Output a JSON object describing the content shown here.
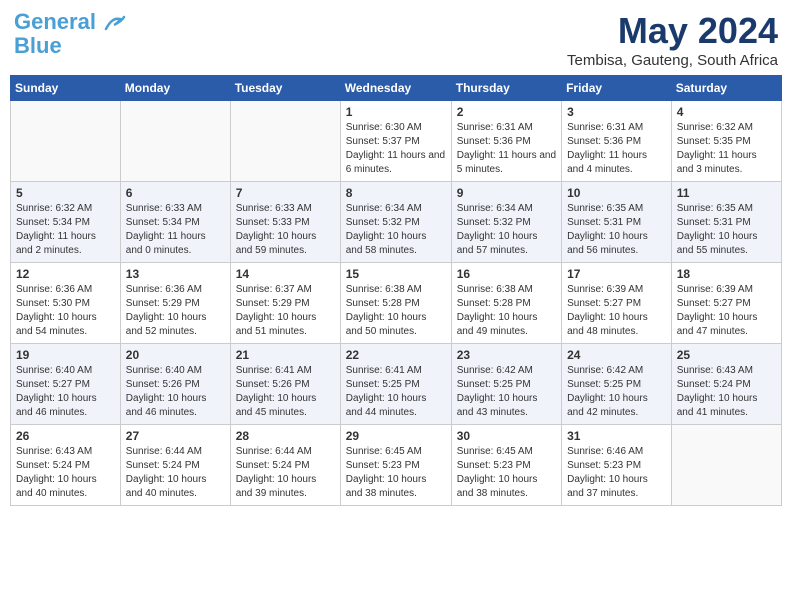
{
  "header": {
    "logo_line1": "General",
    "logo_line2": "Blue",
    "month_title": "May 2024",
    "location": "Tembisa, Gauteng, South Africa"
  },
  "days_of_week": [
    "Sunday",
    "Monday",
    "Tuesday",
    "Wednesday",
    "Thursday",
    "Friday",
    "Saturday"
  ],
  "weeks": [
    [
      {
        "day": "",
        "sunrise": "",
        "sunset": "",
        "daylight": ""
      },
      {
        "day": "",
        "sunrise": "",
        "sunset": "",
        "daylight": ""
      },
      {
        "day": "",
        "sunrise": "",
        "sunset": "",
        "daylight": ""
      },
      {
        "day": "1",
        "sunrise": "Sunrise: 6:30 AM",
        "sunset": "Sunset: 5:37 PM",
        "daylight": "Daylight: 11 hours and 6 minutes."
      },
      {
        "day": "2",
        "sunrise": "Sunrise: 6:31 AM",
        "sunset": "Sunset: 5:36 PM",
        "daylight": "Daylight: 11 hours and 5 minutes."
      },
      {
        "day": "3",
        "sunrise": "Sunrise: 6:31 AM",
        "sunset": "Sunset: 5:36 PM",
        "daylight": "Daylight: 11 hours and 4 minutes."
      },
      {
        "day": "4",
        "sunrise": "Sunrise: 6:32 AM",
        "sunset": "Sunset: 5:35 PM",
        "daylight": "Daylight: 11 hours and 3 minutes."
      }
    ],
    [
      {
        "day": "5",
        "sunrise": "Sunrise: 6:32 AM",
        "sunset": "Sunset: 5:34 PM",
        "daylight": "Daylight: 11 hours and 2 minutes."
      },
      {
        "day": "6",
        "sunrise": "Sunrise: 6:33 AM",
        "sunset": "Sunset: 5:34 PM",
        "daylight": "Daylight: 11 hours and 0 minutes."
      },
      {
        "day": "7",
        "sunrise": "Sunrise: 6:33 AM",
        "sunset": "Sunset: 5:33 PM",
        "daylight": "Daylight: 10 hours and 59 minutes."
      },
      {
        "day": "8",
        "sunrise": "Sunrise: 6:34 AM",
        "sunset": "Sunset: 5:32 PM",
        "daylight": "Daylight: 10 hours and 58 minutes."
      },
      {
        "day": "9",
        "sunrise": "Sunrise: 6:34 AM",
        "sunset": "Sunset: 5:32 PM",
        "daylight": "Daylight: 10 hours and 57 minutes."
      },
      {
        "day": "10",
        "sunrise": "Sunrise: 6:35 AM",
        "sunset": "Sunset: 5:31 PM",
        "daylight": "Daylight: 10 hours and 56 minutes."
      },
      {
        "day": "11",
        "sunrise": "Sunrise: 6:35 AM",
        "sunset": "Sunset: 5:31 PM",
        "daylight": "Daylight: 10 hours and 55 minutes."
      }
    ],
    [
      {
        "day": "12",
        "sunrise": "Sunrise: 6:36 AM",
        "sunset": "Sunset: 5:30 PM",
        "daylight": "Daylight: 10 hours and 54 minutes."
      },
      {
        "day": "13",
        "sunrise": "Sunrise: 6:36 AM",
        "sunset": "Sunset: 5:29 PM",
        "daylight": "Daylight: 10 hours and 52 minutes."
      },
      {
        "day": "14",
        "sunrise": "Sunrise: 6:37 AM",
        "sunset": "Sunset: 5:29 PM",
        "daylight": "Daylight: 10 hours and 51 minutes."
      },
      {
        "day": "15",
        "sunrise": "Sunrise: 6:38 AM",
        "sunset": "Sunset: 5:28 PM",
        "daylight": "Daylight: 10 hours and 50 minutes."
      },
      {
        "day": "16",
        "sunrise": "Sunrise: 6:38 AM",
        "sunset": "Sunset: 5:28 PM",
        "daylight": "Daylight: 10 hours and 49 minutes."
      },
      {
        "day": "17",
        "sunrise": "Sunrise: 6:39 AM",
        "sunset": "Sunset: 5:27 PM",
        "daylight": "Daylight: 10 hours and 48 minutes."
      },
      {
        "day": "18",
        "sunrise": "Sunrise: 6:39 AM",
        "sunset": "Sunset: 5:27 PM",
        "daylight": "Daylight: 10 hours and 47 minutes."
      }
    ],
    [
      {
        "day": "19",
        "sunrise": "Sunrise: 6:40 AM",
        "sunset": "Sunset: 5:27 PM",
        "daylight": "Daylight: 10 hours and 46 minutes."
      },
      {
        "day": "20",
        "sunrise": "Sunrise: 6:40 AM",
        "sunset": "Sunset: 5:26 PM",
        "daylight": "Daylight: 10 hours and 46 minutes."
      },
      {
        "day": "21",
        "sunrise": "Sunrise: 6:41 AM",
        "sunset": "Sunset: 5:26 PM",
        "daylight": "Daylight: 10 hours and 45 minutes."
      },
      {
        "day": "22",
        "sunrise": "Sunrise: 6:41 AM",
        "sunset": "Sunset: 5:25 PM",
        "daylight": "Daylight: 10 hours and 44 minutes."
      },
      {
        "day": "23",
        "sunrise": "Sunrise: 6:42 AM",
        "sunset": "Sunset: 5:25 PM",
        "daylight": "Daylight: 10 hours and 43 minutes."
      },
      {
        "day": "24",
        "sunrise": "Sunrise: 6:42 AM",
        "sunset": "Sunset: 5:25 PM",
        "daylight": "Daylight: 10 hours and 42 minutes."
      },
      {
        "day": "25",
        "sunrise": "Sunrise: 6:43 AM",
        "sunset": "Sunset: 5:24 PM",
        "daylight": "Daylight: 10 hours and 41 minutes."
      }
    ],
    [
      {
        "day": "26",
        "sunrise": "Sunrise: 6:43 AM",
        "sunset": "Sunset: 5:24 PM",
        "daylight": "Daylight: 10 hours and 40 minutes."
      },
      {
        "day": "27",
        "sunrise": "Sunrise: 6:44 AM",
        "sunset": "Sunset: 5:24 PM",
        "daylight": "Daylight: 10 hours and 40 minutes."
      },
      {
        "day": "28",
        "sunrise": "Sunrise: 6:44 AM",
        "sunset": "Sunset: 5:24 PM",
        "daylight": "Daylight: 10 hours and 39 minutes."
      },
      {
        "day": "29",
        "sunrise": "Sunrise: 6:45 AM",
        "sunset": "Sunset: 5:23 PM",
        "daylight": "Daylight: 10 hours and 38 minutes."
      },
      {
        "day": "30",
        "sunrise": "Sunrise: 6:45 AM",
        "sunset": "Sunset: 5:23 PM",
        "daylight": "Daylight: 10 hours and 38 minutes."
      },
      {
        "day": "31",
        "sunrise": "Sunrise: 6:46 AM",
        "sunset": "Sunset: 5:23 PM",
        "daylight": "Daylight: 10 hours and 37 minutes."
      },
      {
        "day": "",
        "sunrise": "",
        "sunset": "",
        "daylight": ""
      }
    ]
  ]
}
